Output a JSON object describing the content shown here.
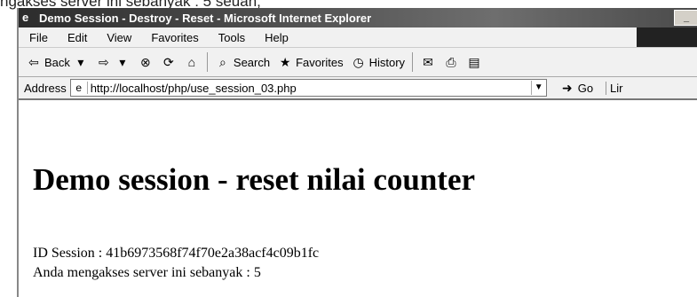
{
  "caption_fragment": "ngakses server ini sebanyak : 5 seuan;",
  "window": {
    "title": "Demo Session - Destroy - Reset - Microsoft Internet Explorer"
  },
  "menu": [
    "File",
    "Edit",
    "View",
    "Favorites",
    "Tools",
    "Help"
  ],
  "toolbar": {
    "back": "Back",
    "search": "Search",
    "favorites": "Favorites",
    "history": "History"
  },
  "address": {
    "label": "Address",
    "url": "http://localhost/php/use_session_03.php",
    "go": "Go",
    "links": "Lir"
  },
  "page": {
    "heading": "Demo session - reset nilai counter",
    "session_line": "ID Session : 41b6973568f74f70e2a38acf4c09b1fc",
    "count_line": "Anda mengakses server ini sebanyak : 5"
  }
}
